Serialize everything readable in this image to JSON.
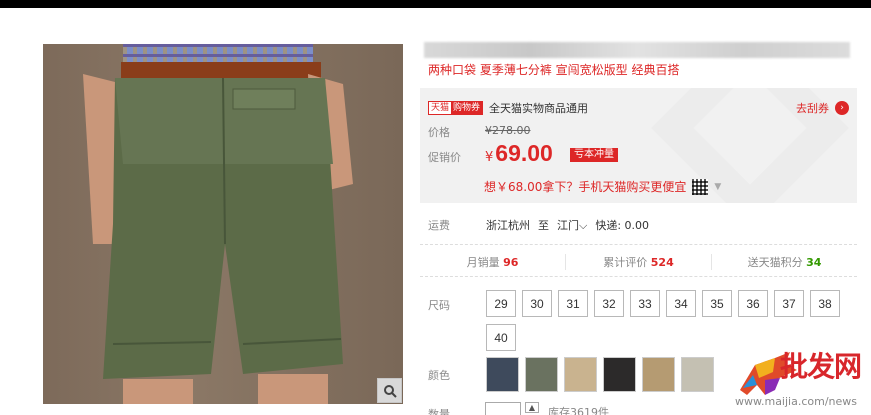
{
  "product": {
    "subtitle": "两种口袋 夏季薄七分裤 宣闯宽松版型 经典百搭"
  },
  "coupon": {
    "tag_a": "天猫",
    "tag_b": "购物券",
    "text": "全天猫实物商品通用",
    "action": "去刮券",
    "action_icon": "chevron-right-icon"
  },
  "price": {
    "original_label": "价格",
    "original_currency": "¥",
    "original_value": "278.00",
    "promo_label": "促销价",
    "currency": "¥",
    "value": "69.00",
    "promo_tag": "亏本冲量",
    "mobile_text": "想￥68.00拿下？手机天猫购买更便宜",
    "accent_color": "#dd2727"
  },
  "shipping": {
    "label": "运费",
    "from": "浙江杭州",
    "to_prefix": "至",
    "to": "江门",
    "express": "快递: 0.00"
  },
  "stats": {
    "monthly_sales_label": "月销量",
    "monthly_sales": "96",
    "reviews_label": "累计评价",
    "reviews": "524",
    "points_label": "送天猫积分",
    "points": "34"
  },
  "sizes": {
    "label": "尺码",
    "options": [
      "29",
      "30",
      "31",
      "32",
      "33",
      "34",
      "35",
      "36",
      "37",
      "38",
      "40"
    ]
  },
  "colors": {
    "label": "颜色",
    "swatches": [
      "#3e4a5c",
      "#6a7260",
      "#c9b38f",
      "#2c2a2a",
      "#b59b72",
      "#c4c0b2"
    ]
  },
  "quantity": {
    "label": "数量",
    "stock": "库存3619件"
  },
  "watermark": {
    "brand": "批发网",
    "url": "www.maijia.com/news"
  }
}
